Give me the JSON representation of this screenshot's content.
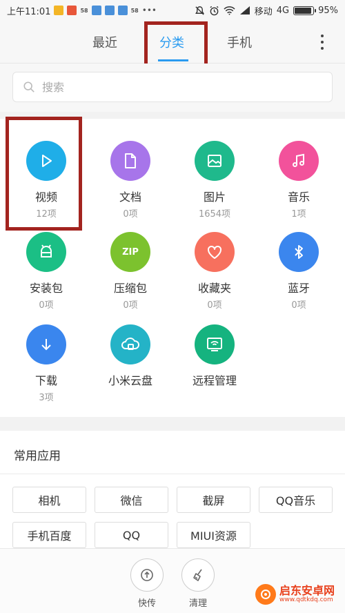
{
  "status_bar": {
    "time": "上午11:01",
    "badge_58": "58",
    "carrier": "移动",
    "network": "4G",
    "battery": "95%",
    "battery_level": 0.95
  },
  "tabs": [
    {
      "label": "最近",
      "active": false
    },
    {
      "label": "分类",
      "active": true
    },
    {
      "label": "手机",
      "active": false
    }
  ],
  "search": {
    "placeholder": "搜索"
  },
  "categories": [
    {
      "name": "视频",
      "count": "12项",
      "icon": "play-icon",
      "color": "#1faee8"
    },
    {
      "name": "文档",
      "count": "0项",
      "icon": "document-icon",
      "color": "#a775ea"
    },
    {
      "name": "图片",
      "count": "1654项",
      "icon": "image-icon",
      "color": "#1fb98c"
    },
    {
      "name": "音乐",
      "count": "1项",
      "icon": "music-note-icon",
      "color": "#f2529b"
    },
    {
      "name": "安装包",
      "count": "0项",
      "icon": "android-icon",
      "color": "#1bbf85"
    },
    {
      "name": "压缩包",
      "count": "0项",
      "icon": "zip-icon",
      "icon_text": "ZIP",
      "color": "#7cc22e"
    },
    {
      "name": "收藏夹",
      "count": "0项",
      "icon": "heart-icon",
      "color": "#f7705e"
    },
    {
      "name": "蓝牙",
      "count": "0项",
      "icon": "bluetooth-icon",
      "color": "#3b86ee"
    },
    {
      "name": "下载",
      "count": "3项",
      "icon": "download-icon",
      "color": "#3a86ee"
    },
    {
      "name": "小米云盘",
      "count": "",
      "icon": "cloud-icon",
      "color": "#24b3c7"
    },
    {
      "name": "远程管理",
      "count": "",
      "icon": "remote-wifi-icon",
      "color": "#15b37f"
    }
  ],
  "common_apps": {
    "title": "常用应用",
    "items": [
      "相机",
      "微信",
      "截屏",
      "QQ音乐",
      "手机百度",
      "QQ",
      "MIUI资源"
    ]
  },
  "toolbar": [
    {
      "label": "快传",
      "icon": "upload-icon"
    },
    {
      "label": "清理",
      "icon": "broom-icon"
    }
  ],
  "watermark": {
    "name": "启东安卓网",
    "url": "www.qdtkdq.com"
  }
}
